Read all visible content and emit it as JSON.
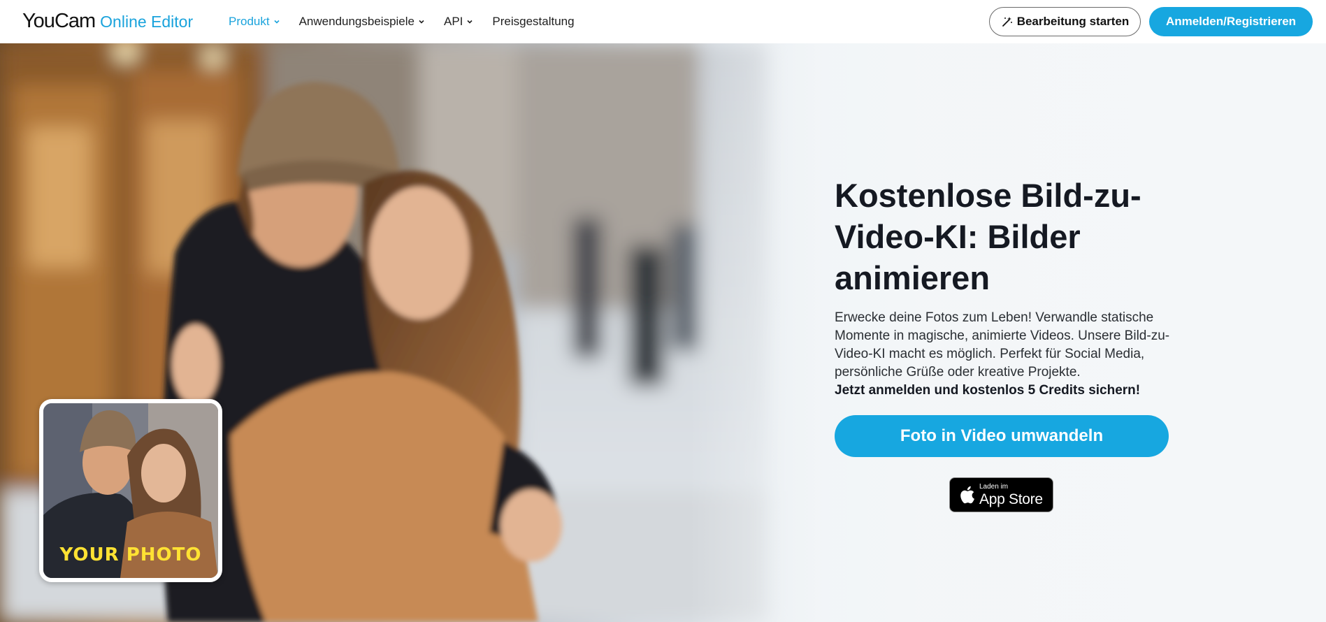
{
  "header": {
    "logo_main": "YouCam",
    "logo_sub": "Online Editor",
    "nav": [
      {
        "label": "Produkt",
        "dropdown": true,
        "active": true
      },
      {
        "label": "Anwendungsbeispiele",
        "dropdown": true,
        "active": false
      },
      {
        "label": "API",
        "dropdown": true,
        "active": false
      },
      {
        "label": "Preisgestaltung",
        "dropdown": false,
        "active": false
      }
    ],
    "start_editing_label": "Bearbeitung starten",
    "signin_label": "Anmelden/Registrieren"
  },
  "hero": {
    "title": "Kostenlose Bild-zu-Video-KI: Bilder animieren",
    "description": "Erwecke deine Fotos zum Leben! Verwandle statische Momente in magische, animierte Videos. Unsere Bild-zu-Video-KI macht es möglich. Perfekt für Social Media, persönliche Grüße oder kreative Projekte.",
    "description_strong": "Jetzt anmelden und kostenlos 5 Credits sichern!",
    "cta_label": "Foto in Video umwandeln",
    "thumbnail_label": "YOUR PHOTO",
    "appstore_small": "Laden im",
    "appstore_big": "App Store"
  },
  "colors": {
    "accent": "#17a7e0",
    "thumbnail_label": "#ffe233",
    "title": "#151922"
  },
  "icons": [
    "chevron-down-icon",
    "magic-wand-icon",
    "apple-icon"
  ]
}
